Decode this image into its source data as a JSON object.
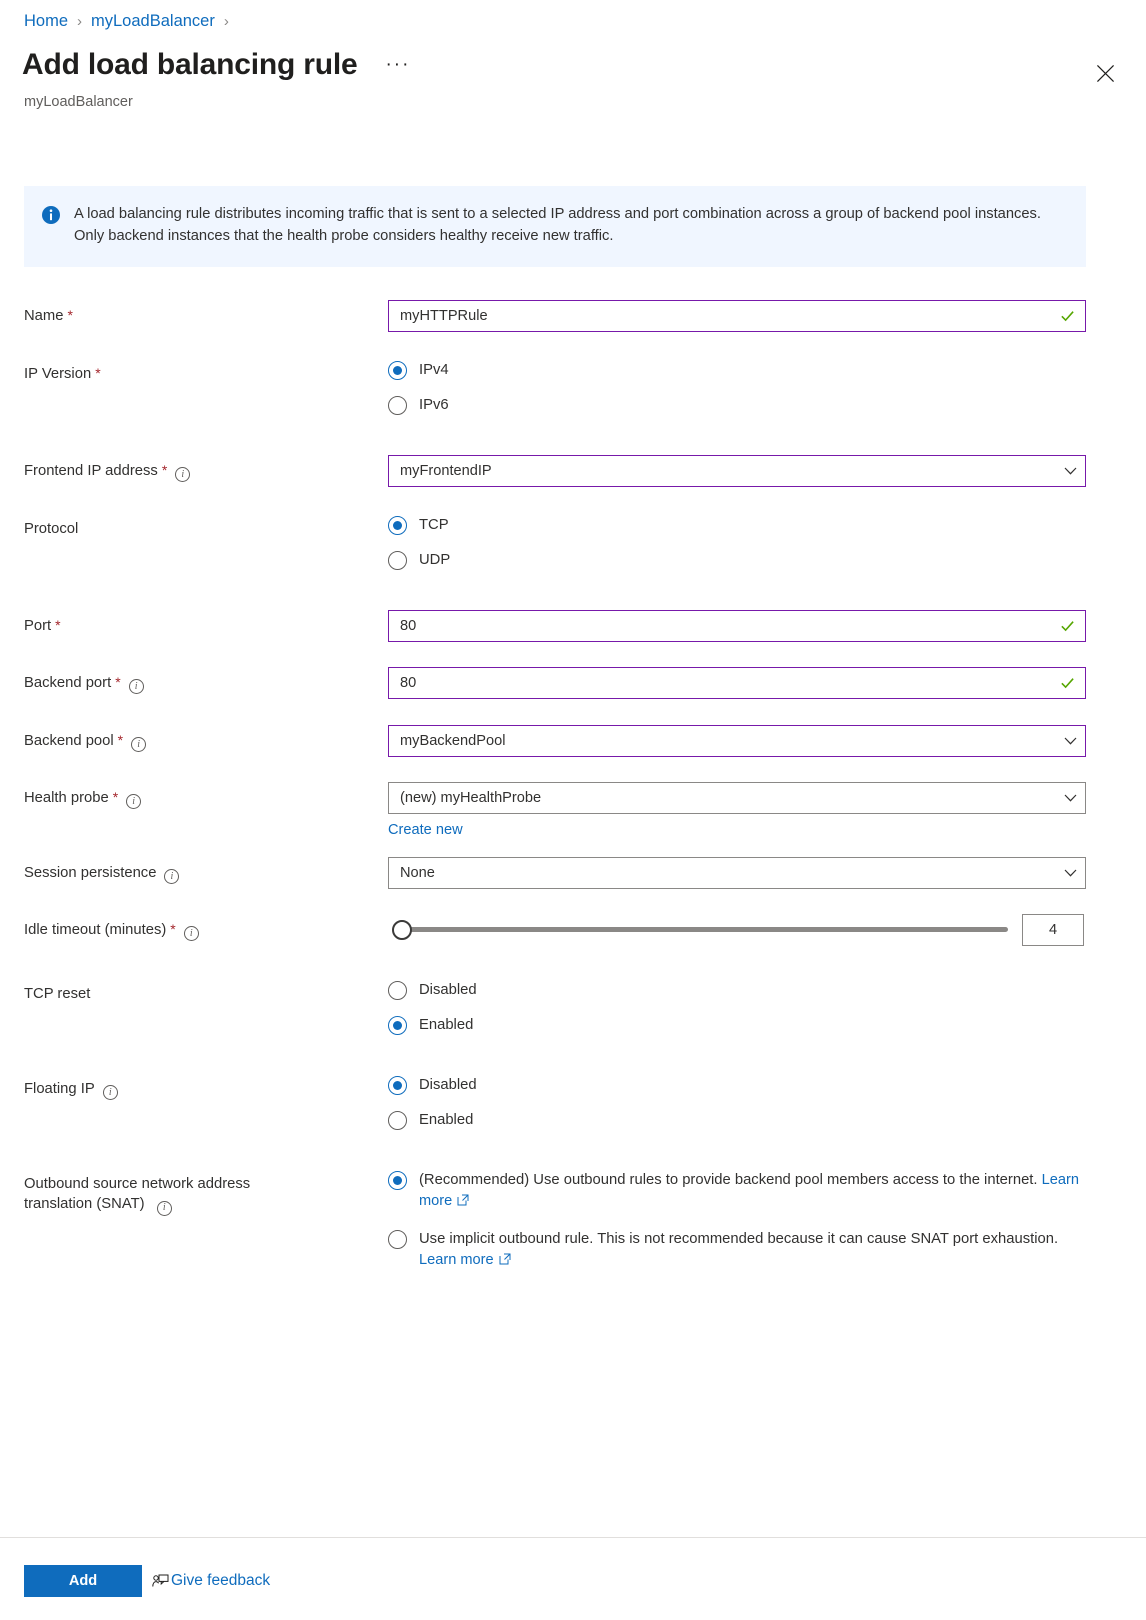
{
  "breadcrumb": {
    "home": "Home",
    "resource": "myLoadBalancer"
  },
  "header": {
    "title": "Add load balancing rule",
    "subtitle": "myLoadBalancer",
    "more_label": "···"
  },
  "banner": {
    "text": "A load balancing rule distributes incoming traffic that is sent to a selected IP address and port combination across a group of backend pool instances. Only backend instances that the health probe considers healthy receive new traffic."
  },
  "form": {
    "name": {
      "label": "Name",
      "value": "myHTTPRule"
    },
    "ip_version": {
      "label": "IP Version",
      "options": [
        "IPv4",
        "IPv6"
      ],
      "selected": "IPv4"
    },
    "frontend_ip": {
      "label": "Frontend IP address",
      "value": "myFrontendIP"
    },
    "protocol": {
      "label": "Protocol",
      "options": [
        "TCP",
        "UDP"
      ],
      "selected": "TCP"
    },
    "port": {
      "label": "Port",
      "value": "80"
    },
    "backend_port": {
      "label": "Backend port",
      "value": "80"
    },
    "backend_pool": {
      "label": "Backend pool",
      "value": "myBackendPool"
    },
    "health_probe": {
      "label": "Health probe",
      "value": "(new) myHealthProbe",
      "create_new": "Create new"
    },
    "session_persistence": {
      "label": "Session persistence",
      "value": "None"
    },
    "idle_timeout": {
      "label": "Idle timeout (minutes)",
      "value": "4"
    },
    "tcp_reset": {
      "label": "TCP reset",
      "options": [
        "Disabled",
        "Enabled"
      ],
      "selected": "Enabled"
    },
    "floating_ip": {
      "label": "Floating IP",
      "options": [
        "Disabled",
        "Enabled"
      ],
      "selected": "Disabled"
    },
    "snat": {
      "label_line1": "Outbound source network address",
      "label_line2": "translation (SNAT)",
      "option1_text": "(Recommended) Use outbound rules to provide backend pool members access to the internet.",
      "option1_link": "Learn more",
      "option2_text": "Use implicit outbound rule. This is not recommended because it can cause SNAT port exhaustion.",
      "option2_link": "Learn more",
      "selected": "option1"
    }
  },
  "footer": {
    "add_label": "Add",
    "feedback_label": "Give feedback"
  },
  "colors": {
    "accent": "#0f6cbd",
    "valid_border": "#7719aa",
    "success": "#55a600",
    "required": "#a4262c",
    "banner_bg": "#f0f6ff"
  }
}
